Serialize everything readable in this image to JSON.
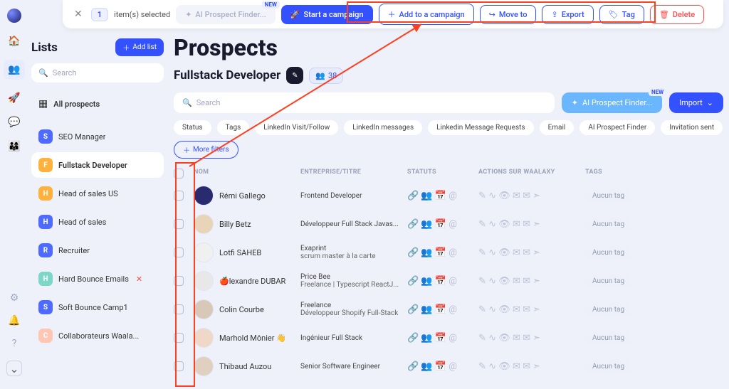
{
  "topbar": {
    "selected_count": "1",
    "selected_text": "item(s) selected",
    "ai_button": "AI Prospect Finder...",
    "new_badge": "NEW",
    "start": "Start a campaign",
    "add": "Add to a campaign",
    "move": "Move to",
    "export": "Export",
    "tag": "Tag",
    "delete": "Delete"
  },
  "sidebar": {
    "title": "Lists",
    "add_list": "Add list",
    "search_ph": "Search",
    "all_prospects": "All prospects",
    "items": [
      {
        "badge": "S",
        "color": "#4f6bff",
        "label": "SEO Manager"
      },
      {
        "badge": "F",
        "color": "#ffb13d",
        "label": "Fullstack Developer",
        "active": true
      },
      {
        "badge": "H",
        "color": "#ffb13d",
        "label": "Head of sales US"
      },
      {
        "badge": "H",
        "color": "#4f6bff",
        "label": "Head of sales"
      },
      {
        "badge": "R",
        "color": "#4f6bff",
        "label": "Recruiter"
      },
      {
        "badge": "H",
        "color": "#7ed6c7",
        "label": "Hard Bounce Emails",
        "x": true
      },
      {
        "badge": "S",
        "color": "#4f6bff",
        "label": "Soft Bounce Camp1"
      },
      {
        "badge": "C",
        "color": "#ffc7b3",
        "label": "Collaborateurs Waala..."
      }
    ]
  },
  "main": {
    "title": "Prospects",
    "list_name": "Fullstack Developer",
    "count": "38",
    "search_ph": "Search",
    "ai_button": "AI Prospect Finder...",
    "new_badge": "NEW",
    "import": "Import",
    "filters": [
      "Status",
      "Tags",
      "LinkedIn Visit/Follow",
      "LinkedIn messages",
      "Linkedin Message Requests",
      "Email",
      "AI Prospect Finder",
      "Invitation sent"
    ],
    "more_filters": "More filters",
    "headers": {
      "nom": "NOM",
      "ent": "ENTREPRISE/TITRE",
      "stat": "STATUTS",
      "act": "ACTIONS SUR WAALAXY",
      "tags": "TAGS"
    },
    "rows": [
      {
        "name": "Rémi Gallego",
        "l1": "Frontend Developer",
        "l2": ""
      },
      {
        "name": "Billy Betz",
        "l1": "Développeur Full Stack Javas...",
        "l2": ""
      },
      {
        "name": "Lotfi SAHEB",
        "l1": "Exaprint",
        "l2": "scrum master à la carte"
      },
      {
        "name": "🍎lexandre DUBAR",
        "l1": "Price Bee",
        "l2": "Freelance | Typescript ReactJ..."
      },
      {
        "name": "Colin Courbe",
        "l1": "Freelance",
        "l2": "Développeur Shopify Full-Stack"
      },
      {
        "name": "Marhold Mônier 👋",
        "l1": "Ingénieur Full Stack",
        "l2": ""
      },
      {
        "name": "Thibaud Auzou",
        "l1": "Senior Software Engineer",
        "l2": ""
      }
    ],
    "no_tag": "Aucun tag"
  }
}
